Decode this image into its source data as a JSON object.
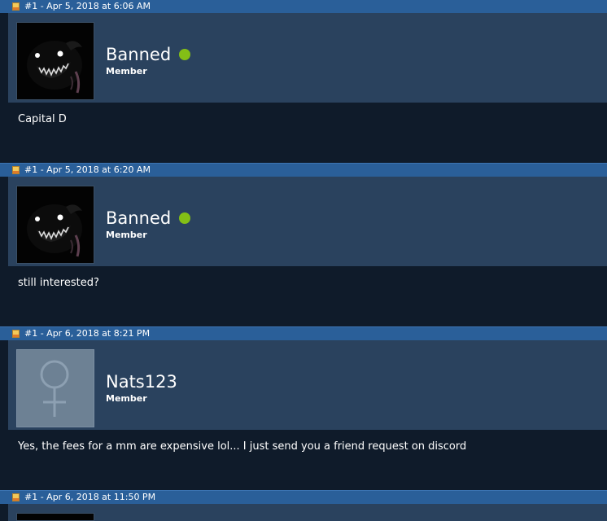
{
  "posts": [
    {
      "header": "#1 - Apr 5, 2018 at 6:06 AM",
      "username": "Banned",
      "user_title": "Member",
      "online": true,
      "avatar": "dark-monster-grin-avatar",
      "message": "Capital D"
    },
    {
      "header": "#1 - Apr 5, 2018 at 6:20 AM",
      "username": "Banned",
      "user_title": "Member",
      "online": true,
      "avatar": "dark-monster-grin-avatar",
      "message": "still interested?"
    },
    {
      "header": "#1 - Apr 6, 2018 at 8:21 PM",
      "username": "Nats123",
      "user_title": "Member",
      "online": false,
      "avatar": "female-symbol-default-avatar",
      "message": "Yes, the fees for a mm are expensive lol... I just send you a friend request on discord"
    },
    {
      "header": "#1 - Apr 6, 2018 at 11:50 PM",
      "avatar": "dark-monster-grin-avatar"
    }
  ],
  "colors": {
    "header_bar": "#2a5f99",
    "user_panel": "#2a425e",
    "message_bg": "#0f1b2a",
    "online_dot": "#83bf16"
  }
}
